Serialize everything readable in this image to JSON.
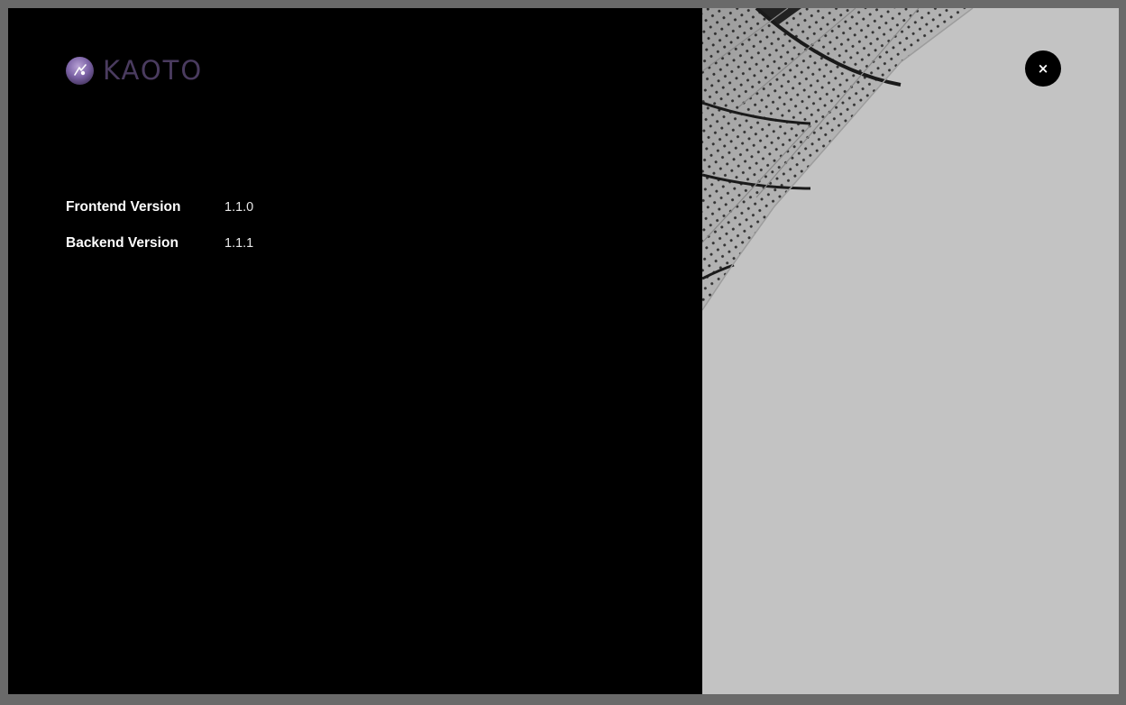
{
  "brand": {
    "name": "KAOTO",
    "logo_icon": "kaoto-logo-icon",
    "logo_color": "#8e75b5",
    "text_color": "#4a3b5f"
  },
  "versions": [
    {
      "label": "Frontend Version",
      "value": "1.1.0"
    },
    {
      "label": "Backend Version",
      "value": "1.1.1"
    }
  ],
  "close_button": {
    "label": "×",
    "icon": "close-icon"
  },
  "colors": {
    "left_panel": "#000000",
    "backdrop": "#6a6a6a",
    "sky": "#c2c2c2"
  }
}
